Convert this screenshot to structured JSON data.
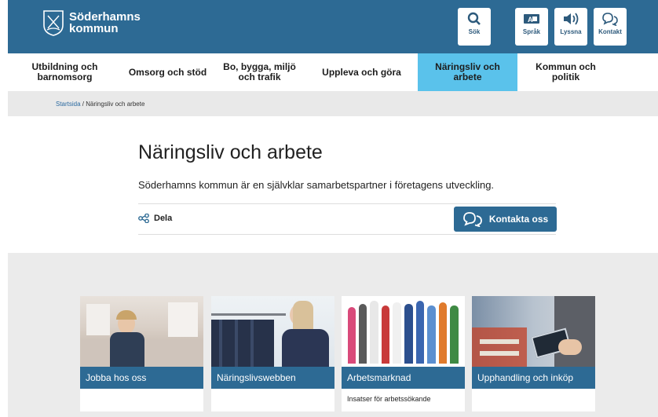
{
  "header": {
    "logo_line1": "Söderhamns",
    "logo_line2": "kommun",
    "tools": [
      {
        "label": "Sök",
        "icon": "search-icon"
      },
      {
        "label": "Språk",
        "icon": "language-icon"
      },
      {
        "label": "Lyssna",
        "icon": "speaker-icon"
      },
      {
        "label": "Kontakt",
        "icon": "chat-icon"
      }
    ]
  },
  "nav": {
    "items": [
      {
        "label": "Utbildning och\nbarnomsorg"
      },
      {
        "label": "Omsorg och stöd"
      },
      {
        "label": "Bo, bygga, miljö\noch trafik"
      },
      {
        "label": "Uppleva och göra"
      },
      {
        "label": "Näringsliv och\narbete"
      },
      {
        "label": "Kommun och\npolitik"
      }
    ],
    "active_index": 4
  },
  "breadcrumb": {
    "home": "Startsida",
    "separator": " / ",
    "current": "Näringsliv och arbete"
  },
  "main": {
    "title": "Näringsliv och arbete",
    "intro": "Söderhamns kommun är en självklar samarbetspartner i företagens utveckling.",
    "share_label": "Dela",
    "contact_label": "Kontakta oss"
  },
  "cards": [
    {
      "title": "Jobba hos oss",
      "subtitle": ""
    },
    {
      "title": "Näringslivswebben",
      "subtitle": ""
    },
    {
      "title": "Arbetsmarknad",
      "subtitle": "Insatser för arbetssökande"
    },
    {
      "title": "Upphandling och inköp",
      "subtitle": ""
    }
  ],
  "colors": {
    "brand": "#2d6a94",
    "active_nav": "#5ac2eb",
    "gray": "#ebebeb"
  }
}
